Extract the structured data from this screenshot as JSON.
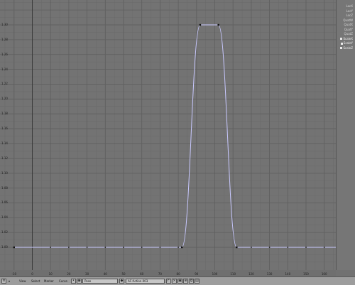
{
  "y_axis": {
    "ticks": [
      "1.30",
      "1.28",
      "1.26",
      "1.24",
      "1.22",
      "1.20",
      "1.18",
      "1.16",
      "1.14",
      "1.12",
      "1.10",
      "1.08",
      "1.06",
      "1.04",
      "1.02",
      "1.00"
    ]
  },
  "x_axis": {
    "ticks": [
      "-10",
      "0",
      "10",
      "20",
      "30",
      "40",
      "50",
      "60",
      "70",
      "80",
      "90",
      "100",
      "110",
      "120",
      "130",
      "140",
      "150",
      "160"
    ]
  },
  "ipo_curve": {
    "channel": "ScaleX",
    "keyframes": [
      {
        "frame": -10,
        "value": 1.0
      },
      {
        "frame": 82,
        "value": 1.0
      },
      {
        "frame": 92,
        "value": 1.3
      },
      {
        "frame": 102,
        "value": 1.3
      },
      {
        "frame": 112,
        "value": 1.0
      },
      {
        "frame": 170,
        "value": 1.0
      }
    ]
  },
  "channels": [
    {
      "label": "LocX",
      "selected": false
    },
    {
      "label": "LocY",
      "selected": false
    },
    {
      "label": "LocZ",
      "selected": false
    },
    {
      "label": "QuatW",
      "selected": false
    },
    {
      "label": "QuatX",
      "selected": false
    },
    {
      "label": "QuatY",
      "selected": false
    },
    {
      "label": "QuatZ",
      "selected": false
    },
    {
      "label": "ScaleX",
      "selected": true
    },
    {
      "label": "ScaleY",
      "selected": true
    },
    {
      "label": "ScaleZ",
      "selected": true
    }
  ],
  "header": {
    "view_menu": "View",
    "select_menu": "Select",
    "marker_menu": "Marker",
    "curve_menu": "Curve",
    "ipo_type": "Pose",
    "action_name": "AC:Action.003",
    "view_type_icon": "ipo-icon",
    "colors": {
      "curve": "#c8c8ff",
      "current_frame": "#3a3a3a"
    }
  }
}
